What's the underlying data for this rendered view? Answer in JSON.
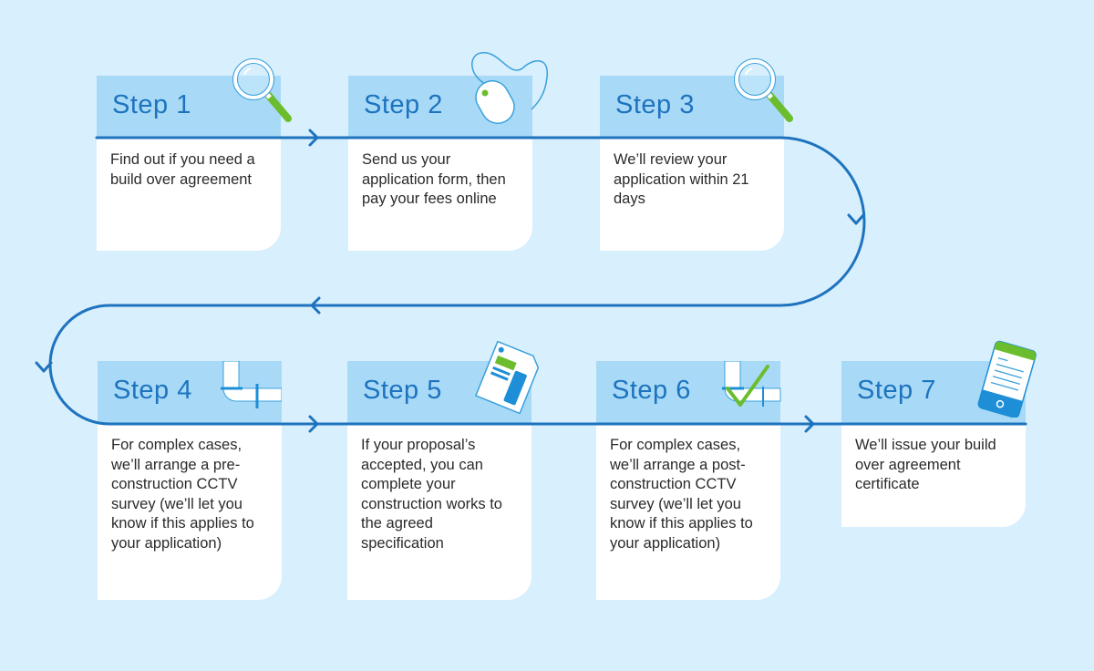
{
  "diagram": {
    "type": "process-flow",
    "colors": {
      "background": "#d8effd",
      "header": "#a8daf7",
      "card": "#ffffff",
      "line": "#1e73be",
      "accent_green": "#6cbd2d",
      "title_text": "#1e73be"
    },
    "steps": [
      {
        "title": "Step 1",
        "text": "Find out if you need a build over agreement",
        "icon": "magnifier-icon"
      },
      {
        "title": "Step 2",
        "text": "Send us your application form, then pay your fees online",
        "icon": "mouse-icon"
      },
      {
        "title": "Step 3",
        "text": "We’ll review your application within 21 days",
        "icon": "magnifier-icon"
      },
      {
        "title": "Step 4",
        "text": "For complex cases, we’ll arrange a pre-construction CCTV survey (we’ll let you know if this applies to your application)",
        "icon": "pipe-icon"
      },
      {
        "title": "Step 5",
        "text": "If your proposal’s accepted, you can complete your construction works to the agreed specification",
        "icon": "document-icon"
      },
      {
        "title": "Step 6",
        "text": "For complex cases, we’ll arrange a post-construction CCTV survey (we’ll let you know if this applies to your application)",
        "icon": "pipe-check-icon"
      },
      {
        "title": "Step 7",
        "text": "We’ll issue your build over agreement certificate",
        "icon": "mobile-certificate-icon"
      }
    ]
  }
}
